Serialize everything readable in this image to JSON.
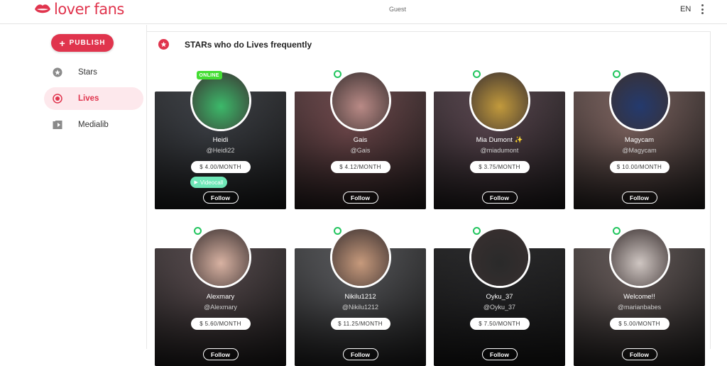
{
  "header": {
    "logo_text": "lover fans",
    "center_label": "Guest",
    "language": "EN",
    "menu_icon": "kebab-menu-icon",
    "brand_color": "#e0344d"
  },
  "sidebar": {
    "publish_label": "PUBLISH",
    "items": [
      {
        "label": "Stars",
        "icon": "star-icon",
        "active": false
      },
      {
        "label": "Lives",
        "icon": "live-icon",
        "active": true
      },
      {
        "label": "Medialib",
        "icon": "media-library-icon",
        "active": false
      }
    ]
  },
  "section": {
    "title": "STARs who do Lives frequently",
    "icon": "star-icon"
  },
  "cards": [
    {
      "name": "Heidi",
      "handle": "@Heidi22",
      "price": "$ 4.00/MONTH",
      "badge": "ONLINE",
      "videocall": "Videocall",
      "follow": "Follow",
      "bg": "#4a4e55",
      "avatar_bg": "#3cb96a"
    },
    {
      "name": "Gais",
      "handle": "@Gais",
      "price": "$ 4.12/MONTH",
      "follow": "Follow",
      "bg": "#8a5a5e",
      "avatar_bg": "#b98a86"
    },
    {
      "name": "Mia Dumont ✨",
      "handle": "@miadumont",
      "price": "$ 3.75/MONTH",
      "follow": "Follow",
      "bg": "#6d5560",
      "avatar_bg": "#c29a3c"
    },
    {
      "name": "Magycam",
      "handle": "@Magycam",
      "price": "$ 10.00/MONTH",
      "follow": "Follow",
      "bg": "#9b7b76",
      "avatar_bg": "#243a6e"
    },
    {
      "name": "Alexmary",
      "handle": "@Alexmary",
      "price": "$ 5.60/MONTH",
      "follow": "Follow",
      "bg": "#6a5b5e",
      "avatar_bg": "#d8b2a2"
    },
    {
      "name": "Nikilu1212",
      "handle": "@Nikilu1212",
      "price": "$ 11.25/MONTH",
      "follow": "Follow",
      "bg": "#6b6c70",
      "avatar_bg": "#c79a7c"
    },
    {
      "name": "Oyku_37",
      "handle": "@Oyku_37",
      "price": "$ 7.50/MONTH",
      "follow": "Follow",
      "bg": "#2e2e30",
      "avatar_bg": "#2a2a2a"
    },
    {
      "name": "Welcome!!",
      "handle": "@marianbabes",
      "price": "$ 5.00/MONTH",
      "follow": "Follow",
      "bg": "#7d6f6d",
      "avatar_bg": "#cfc6c2"
    }
  ]
}
